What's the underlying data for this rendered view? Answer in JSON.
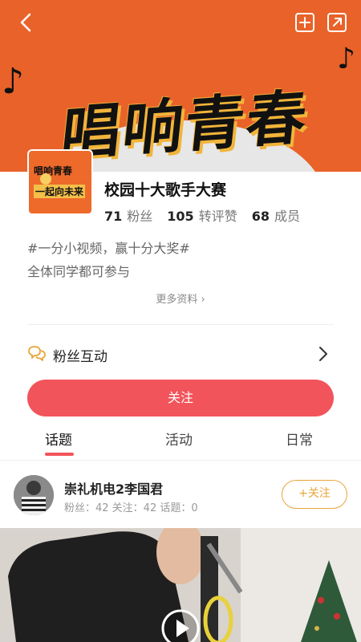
{
  "banner": {
    "title_art": "唱响青春",
    "colors": {
      "orange": "#E9622A",
      "accent_yellow": "#f1b43a"
    }
  },
  "topbar": {
    "back_icon": "back-chevron-icon",
    "add_icon": "add-square-icon",
    "share_icon": "share-square-icon"
  },
  "avatar": {
    "line1": "唱响青春",
    "line2": "一起向未来"
  },
  "group": {
    "name": "校园十大歌手大赛",
    "stats": [
      {
        "num": "71",
        "label": "粉丝"
      },
      {
        "num": "105",
        "label": "转评赞"
      },
      {
        "num": "68",
        "label": "成员"
      }
    ],
    "desc_line1": "#一分小视频，赢十分大奖#",
    "desc_line2": "全体同学都可参与",
    "more": "更多资料"
  },
  "fans": {
    "label": "粉丝互动",
    "icon": "chat-bubbles-icon"
  },
  "follow": {
    "label": "关注",
    "color": "#F2545B"
  },
  "tabs": [
    {
      "label": "话题",
      "active": true
    },
    {
      "label": "活动",
      "active": false
    },
    {
      "label": "日常",
      "active": false
    }
  ],
  "post": {
    "author": "崇礼机电2李国君",
    "meta": "粉丝：42  关注：42  话题：0",
    "follow_label": "+关注",
    "follow_color": "#E9A53A"
  },
  "media": {
    "play_icon": "play-circle-icon"
  }
}
